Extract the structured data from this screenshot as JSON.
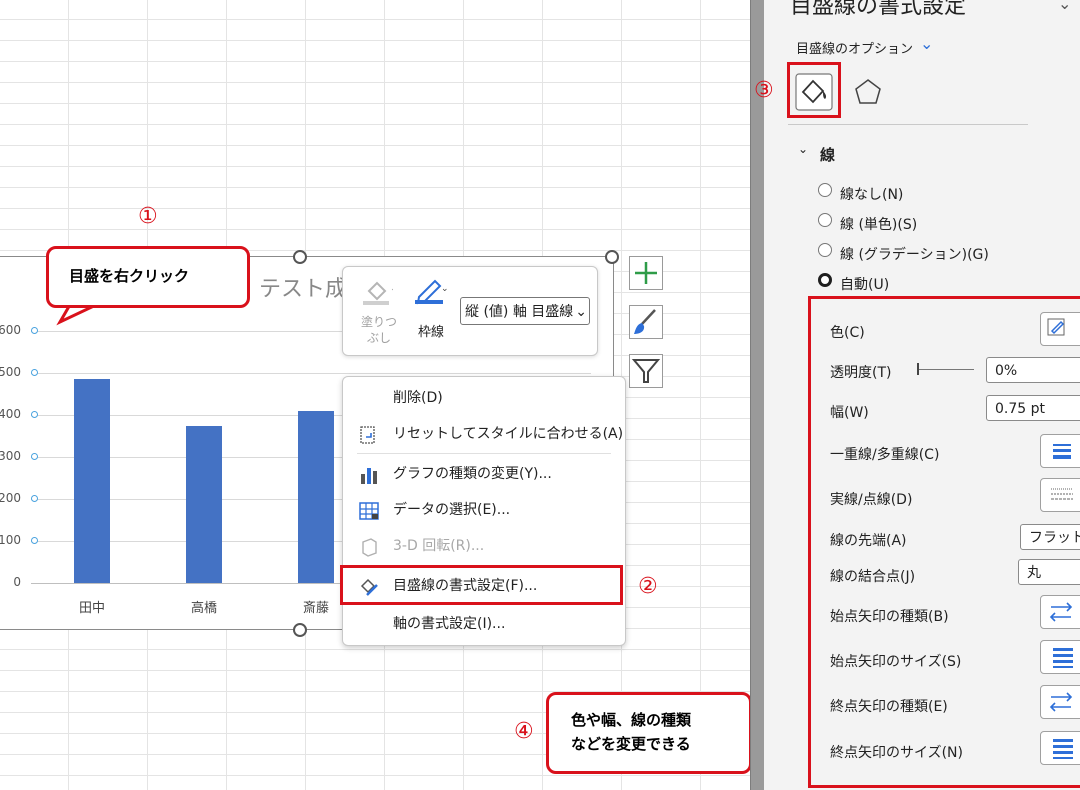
{
  "annotations": {
    "step1": "①",
    "step2": "②",
    "step3": "③",
    "step4": "④",
    "callout1": "目盛を右クリック",
    "callout4_line1": "色や幅、線の種類",
    "callout4_line2": "などを変更できる"
  },
  "chart": {
    "title_partial": "テスト成績",
    "y_ticks": [
      "600",
      "500",
      "400",
      "300",
      "200",
      "100",
      "0"
    ],
    "x_ticks": [
      "田中",
      "高橋",
      "斎藤"
    ]
  },
  "chart_data": {
    "type": "bar",
    "categories": [
      "田中",
      "高橋",
      "斎藤"
    ],
    "values": [
      485,
      375,
      410
    ],
    "title": "テスト成績",
    "ylim": [
      0,
      600
    ],
    "yticks": [
      0,
      100,
      200,
      300,
      400,
      500,
      600
    ],
    "bar_color": "#4472c4",
    "grid": true
  },
  "minibar": {
    "fill_label_1": "塗りつ",
    "fill_label_2": "ぶし",
    "outline_label": "枠線",
    "element_select": "縦 (値) 軸 目盛線"
  },
  "context_menu": {
    "items": [
      {
        "label": "削除(D)",
        "icon": ""
      },
      {
        "label": "リセットしてスタイルに合わせる(A)",
        "icon": "reset-style-icon"
      },
      {
        "label": "グラフの種類の変更(Y)...",
        "icon": "chart-type-icon"
      },
      {
        "label": "データの選択(E)...",
        "icon": "select-data-icon"
      },
      {
        "label": "3-D 回転(R)...",
        "icon": "3d-rotation-icon"
      },
      {
        "label": "目盛線の書式設定(F)...",
        "icon": "format-gridlines-icon"
      },
      {
        "label": "軸の書式設定(I)...",
        "icon": ""
      }
    ]
  },
  "pane": {
    "title": "目盛線の書式設定",
    "options_label": "目盛線のオプション",
    "section_line": "線",
    "radios": [
      "線なし(N)",
      "線 (単色)(S)",
      "線 (グラデーション)(G)",
      "自動(U)"
    ],
    "selected_radio": "自動(U)",
    "props": {
      "color_label": "色(C)",
      "transparency_label": "透明度(T)",
      "transparency_value": "0%",
      "width_label": "幅(W)",
      "width_value": "0.75 pt",
      "compound_label": "一重線/多重線(C)",
      "dash_label": "実線/点線(D)",
      "cap_label": "線の先端(A)",
      "cap_value": "フラット",
      "join_label": "線の結合点(J)",
      "join_value": "丸",
      "begin_arrow_type_label": "始点矢印の種類(B)",
      "begin_arrow_size_label": "始点矢印のサイズ(S)",
      "end_arrow_type_label": "終点矢印の種類(E)",
      "end_arrow_size_label": "終点矢印のサイズ(N)"
    }
  },
  "colors": {
    "accent_red": "#d9111b",
    "bar_blue": "#4472c4",
    "outline_blue": "#2e6fd8"
  }
}
